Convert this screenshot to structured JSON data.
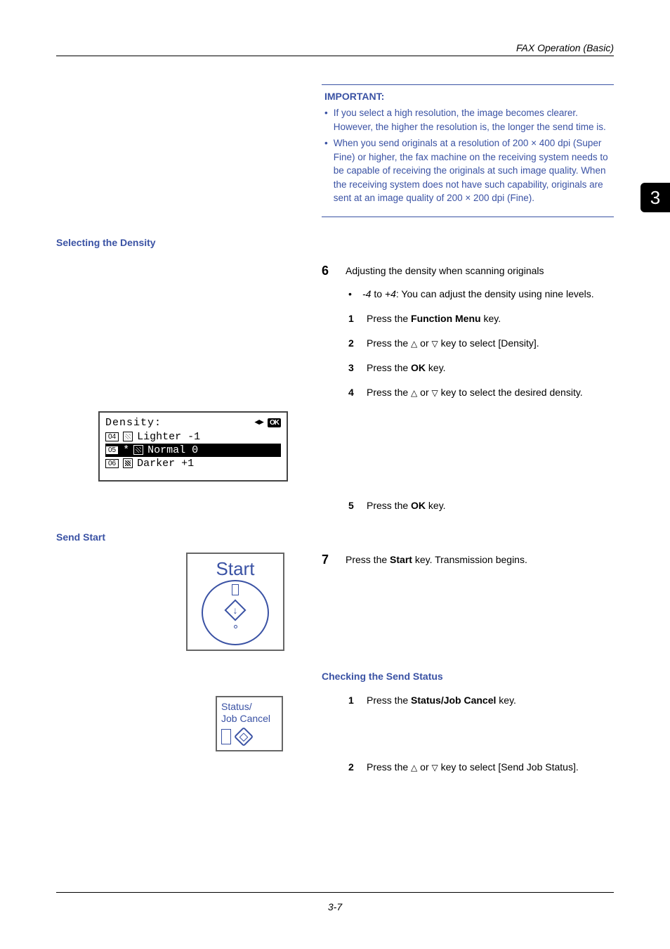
{
  "running_head": "FAX Operation (Basic)",
  "chapter_tab": "3",
  "important": {
    "title": "IMPORTANT:",
    "bullets": [
      "If you select a high resolution, the image becomes clearer. However, the higher the resolution is, the longer the send time is.",
      "When you send originals at a resolution of 200 × 400 dpi (Super Fine) or higher, the fax machine on the receiving system needs to be capable of receiving the originals at such image quality. When the receiving system does not have such capability, originals are sent at an image quality of 200 × 200 dpi (Fine)."
    ]
  },
  "density": {
    "heading": "Selecting the Density",
    "step_num": "6",
    "step_text": "Adjusting the density when scanning originals",
    "range_prefix": "-4",
    "range_mid": " to ",
    "range_suffix": "+4",
    "range_tail": ": You can adjust the density using nine levels.",
    "sub": [
      {
        "n": "1",
        "pre": "Press the ",
        "bold": "Function Menu",
        "post": " key."
      },
      {
        "n": "2",
        "pre": "Press the ",
        "tri1": "△",
        "mid": " or ",
        "tri2": "▽",
        "post": " key to select [Density]."
      },
      {
        "n": "3",
        "pre": "Press the ",
        "bold": "OK",
        "post": " key."
      },
      {
        "n": "4",
        "pre": "Press the ",
        "tri1": "△",
        "mid": " or ",
        "tri2": "▽",
        "post": " key to select the desired density."
      },
      {
        "n": "5",
        "pre": "Press the ",
        "bold": "OK",
        "post": " key."
      }
    ],
    "lcd": {
      "title": "Density:",
      "ok": "OK",
      "items": [
        {
          "tag": "04",
          "txt": "Lighter -1",
          "cls": "l"
        },
        {
          "tag": "05",
          "star": "*",
          "txt": "Normal 0",
          "sel": true,
          "cls": ""
        },
        {
          "tag": "06",
          "txt": "Darker +1",
          "cls": "d"
        }
      ]
    }
  },
  "start": {
    "heading": "Send Start",
    "step_num": "7",
    "pre": "Press the ",
    "bold": "Start",
    "post": " key. Transmission begins.",
    "btn_label": "Start"
  },
  "check": {
    "heading": "Checking the Send Status",
    "sub": [
      {
        "n": "1",
        "pre": "Press the ",
        "bold": "Status/Job Cancel",
        "post": " key."
      },
      {
        "n": "2",
        "pre": "Press the ",
        "tri1": "△",
        "mid": " or ",
        "tri2": "▽",
        "post": " key to select [Send Job Status]."
      }
    ],
    "btn_l1": "Status/",
    "btn_l2": "Job Cancel"
  },
  "footer": "3-7"
}
